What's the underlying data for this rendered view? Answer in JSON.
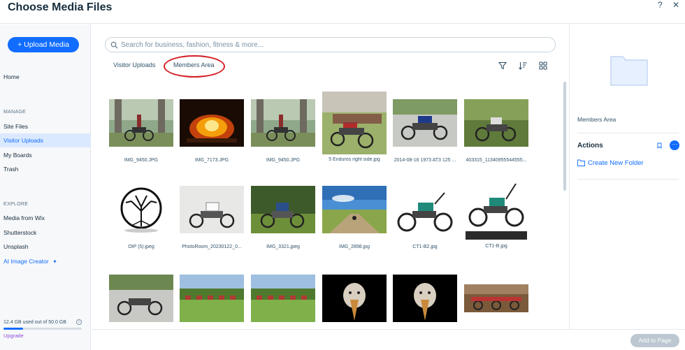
{
  "header": {
    "title": "Choose Media Files",
    "help": "?",
    "close": "✕"
  },
  "sidebar": {
    "upload_button": "+ Upload Media",
    "home": "Home",
    "manage_label": "MANAGE",
    "manage_items": [
      "Site Files",
      "Visitor Uploads",
      "My Boards",
      "Trash"
    ],
    "explore_label": "EXPLORE",
    "explore_items": [
      "Media from Wix",
      "Shutterstock",
      "Unsplash",
      "AI Image Creator"
    ],
    "storage_text": "12.4 GB used out of 50.0 GB",
    "storage_used_fraction": 0.248,
    "upgrade": "Upgrade"
  },
  "main": {
    "search_placeholder": "Search for business, fashion, fitness & more...",
    "tabs": [
      "Visitor Uploads",
      "Members Area"
    ],
    "files": [
      "IMG_9450.JPG",
      "IMG_7173.JPG",
      "IMG_9450.JPG",
      "5 Enduros right side.jpg",
      "2014-08-16 1973 AT3 125 ...",
      "403315_11340955544555...",
      "OIP (5).jpeg",
      "PhotoRoom_20230122_0...",
      "IMG_3321.jpeg",
      "IMG_2898.jpg",
      "CT1-B2.jpg",
      "CT1-B.jpg"
    ]
  },
  "right_panel": {
    "folder_name": "Members Area",
    "actions_title": "Actions",
    "create_folder": "Create New Folder"
  },
  "footer": {
    "add_button": "Add to Page"
  },
  "colors": {
    "accent": "#116dff",
    "highlight": "#d41f26"
  }
}
